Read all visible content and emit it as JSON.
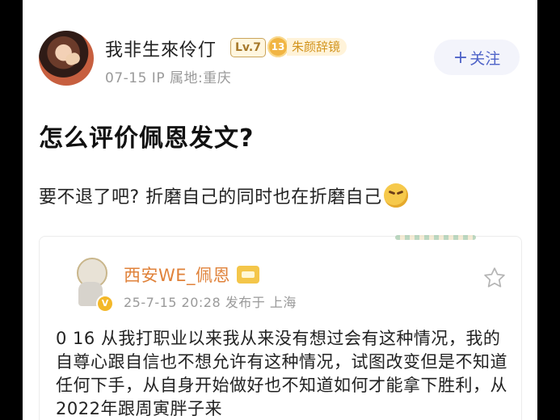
{
  "post": {
    "author": {
      "name": "我非生來伶仃",
      "level": "Lv.7",
      "fan_badge_number": "13",
      "fan_badge_name": "朱颜辞镜"
    },
    "meta": "07-15  IP 属地:重庆",
    "follow_label": "关注",
    "follow_icon": "+",
    "title": "怎么评价佩恩发文?",
    "body": "要不退了吧? 折磨自己的同时也在折磨自己"
  },
  "quoted": {
    "author": {
      "name": "西安WE_佩恩",
      "verified_badge": "V"
    },
    "meta": "25-7-15 20:28  发布于 上海",
    "text": "0 16 从我打职业以来我从来没有想过会有这种情况，我的自尊心跟自信也不想允许有这种情况，试图改变但是不知道任何下手，从自身开始做好也不知道如何才能拿下胜利，从2022年跟周寅胖子来"
  },
  "colors": {
    "accent": "#4f63c8",
    "quoted_name": "#e0823a",
    "meta_gray": "#9a9a9a"
  }
}
